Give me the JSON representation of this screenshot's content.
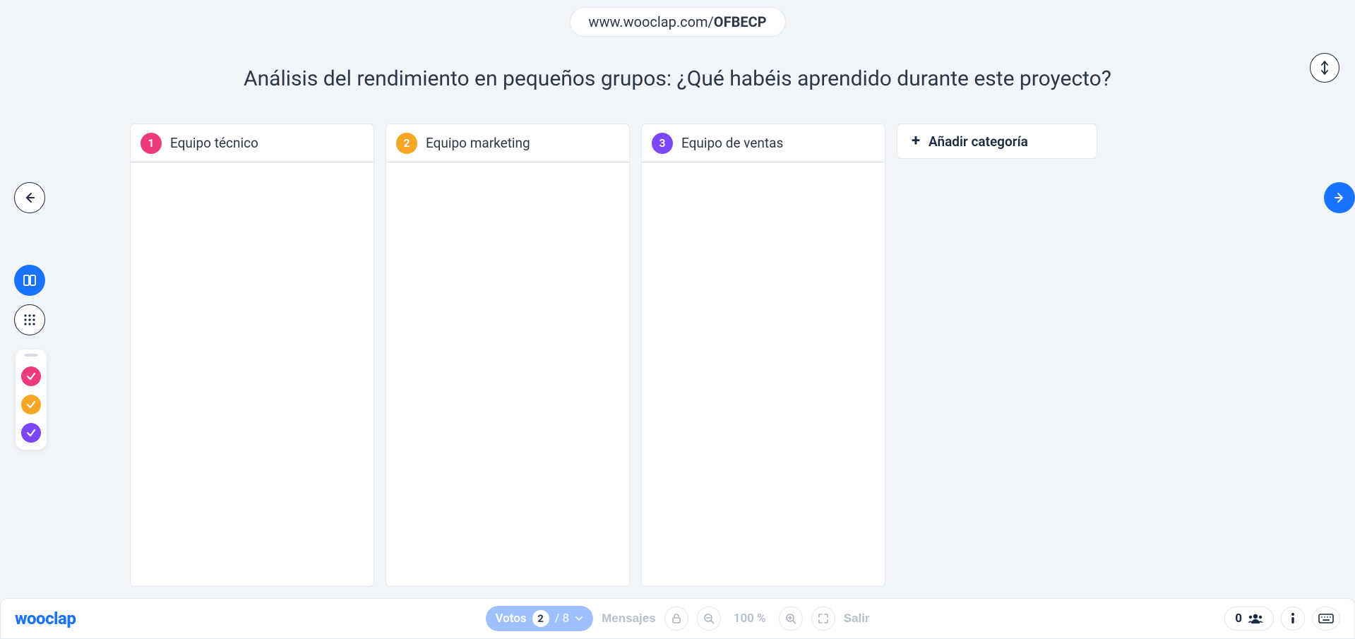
{
  "url": {
    "base": "www.wooclap.com/",
    "code": "OFBECP"
  },
  "question": "Análisis del rendimiento en pequeños grupos: ¿Qué habéis aprendido durante este proyecto?",
  "columns": [
    {
      "index": "1",
      "title": "Equipo técnico",
      "color": "pink"
    },
    {
      "index": "2",
      "title": "Equipo marketing",
      "color": "orange"
    },
    {
      "index": "3",
      "title": "Equipo de ventas",
      "color": "purple"
    }
  ],
  "add_category_label": "Añadir categoría",
  "filters": [
    {
      "color": "pink"
    },
    {
      "color": "orange"
    },
    {
      "color": "purple"
    }
  ],
  "bottom": {
    "logo": "wooclap",
    "votes_label": "Votos",
    "votes_current": "2",
    "votes_total": "/ 8",
    "messages_label": "Mensajes",
    "zoom": "100 %",
    "exit_label": "Salir",
    "participants": "0"
  },
  "colors": {
    "pink": "#ec3b7a",
    "orange": "#f5a623",
    "purple": "#7b47f5",
    "blue": "#1a73ff"
  }
}
